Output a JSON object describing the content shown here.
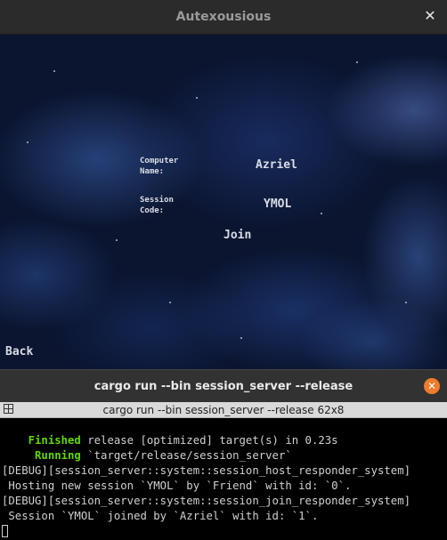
{
  "game_window": {
    "title": "Autexousious",
    "close_glyph": "✕",
    "form": {
      "computer_name_label": "Computer\nName:",
      "computer_name_value": "Azriel",
      "session_code_label": "Session\nCode:",
      "session_code_value": "YMOL",
      "join_label": "Join",
      "back_label": "Back"
    }
  },
  "terminal_window": {
    "title": "cargo run --bin session_server --release",
    "close_glyph": "✕",
    "tab_title": "cargo run --bin session_server --release 62x8",
    "lines": [
      {
        "prefix": "    Finished",
        "text": " release [optimized] target(s) in 0.23s"
      },
      {
        "prefix": "     Running",
        "text": " `target/release/session_server`"
      },
      {
        "prefix": "",
        "text": "[DEBUG][session_server::system::session_host_responder_system]"
      },
      {
        "prefix": "",
        "text": " Hosting new session `YMOL` by `Friend` with id: `0`."
      },
      {
        "prefix": "",
        "text": "[DEBUG][session_server::system::session_join_responder_system]"
      },
      {
        "prefix": "",
        "text": " Session `YMOL` joined by `Azriel` with id: `1`."
      }
    ]
  },
  "colors": {
    "terminal_green": "#5fd700",
    "close_button_orange": "#f07b2b",
    "space_blue": "#0b1530"
  }
}
